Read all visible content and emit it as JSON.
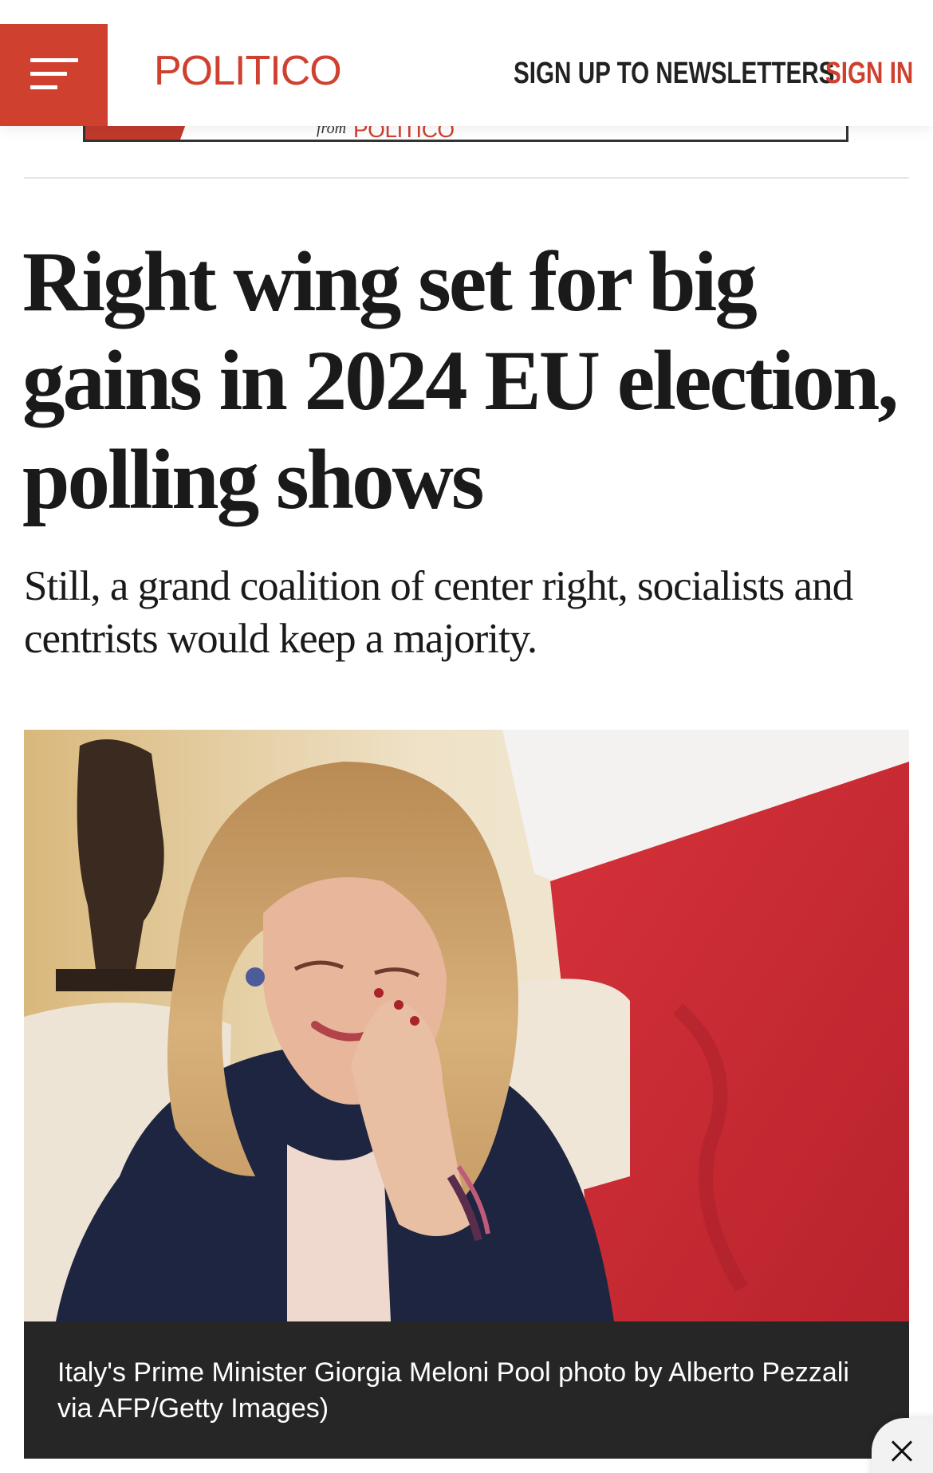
{
  "header": {
    "logo": "POLITICO",
    "newsletters_link": "SIGN UP TO NEWSLETTERS",
    "signin_link": "SIGN IN"
  },
  "ad": {
    "from_text": "from",
    "brand": "POLITICO"
  },
  "article": {
    "headline": "Right wing set for big gains in 2024 EU election, polling shows",
    "dek": "Still, a grand coalition of center right, socialists and centrists would keep a majority.",
    "photo_caption": "Italy's Prime Minister Giorgia Meloni Pool photo by Alberto Pezzali via AFP/Getty Images)"
  },
  "icons": {
    "menu": "hamburger-menu-icon",
    "close": "close-icon"
  },
  "colors": {
    "brand_red": "#d0402f",
    "text": "#1a1a1a",
    "caption_bg": "#262626"
  }
}
